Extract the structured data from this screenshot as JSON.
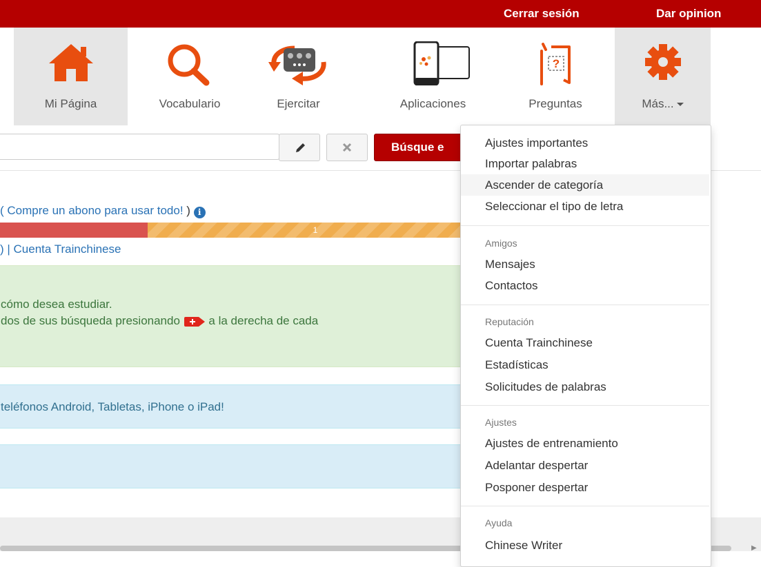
{
  "topbar": {
    "logout": "Cerrar sesión",
    "feedback": "Dar opinion"
  },
  "nav": [
    {
      "label": "Mi Página",
      "icon": "home-icon",
      "active": true
    },
    {
      "label": "Vocabulario",
      "icon": "magnifier-icon"
    },
    {
      "label": "Ejercitar",
      "icon": "flashcard-cycle-icon"
    },
    {
      "label": "Aplicaciones",
      "icon": "phone-tablet-icon"
    },
    {
      "label": "Preguntas",
      "icon": "question-character-icon"
    },
    {
      "label": "Más...",
      "icon": "gear-icon",
      "open": true
    }
  ],
  "search": {
    "value": "",
    "button_label": "Búsque e"
  },
  "content": {
    "purchase_prefix": "( ",
    "purchase_link": "Compre un abono para usar todo!",
    "purchase_suffix": " )",
    "progress": {
      "red_fraction": 0.306,
      "orange_label": "1"
    },
    "account_sep": ") | ",
    "account_link": "Cuenta Trainchinese",
    "success_line1": "cómo desea estudiar.",
    "success_line2_a": "dos de sus búsqueda presionando",
    "success_line2_b": "a la derecha de cada",
    "info_line1": "teléfonos Android, Tabletas, iPhone o iPad!"
  },
  "dropdown": {
    "group1": [
      "Ajustes importantes",
      "Importar palabras",
      "Ascender de categoría",
      "Seleccionar el tipo de letra"
    ],
    "group2_header": "Amigos",
    "group2": [
      "Mensajes",
      "Contactos"
    ],
    "group3_header": "Reputación",
    "group3": [
      "Cuenta Trainchinese",
      "Estadísticas",
      "Solicitudes de palabras"
    ],
    "group4_header": "Ajustes",
    "group4": [
      "Ajustes de entrenamiento",
      "Adelantar despertar",
      "Posponer despertar"
    ],
    "group5_header": "Ayuda",
    "group5": [
      "Chinese Writer"
    ]
  },
  "colors": {
    "brand_red": "#b50000",
    "icon_orange": "#e84e0f",
    "link_blue": "#2a72b5"
  }
}
